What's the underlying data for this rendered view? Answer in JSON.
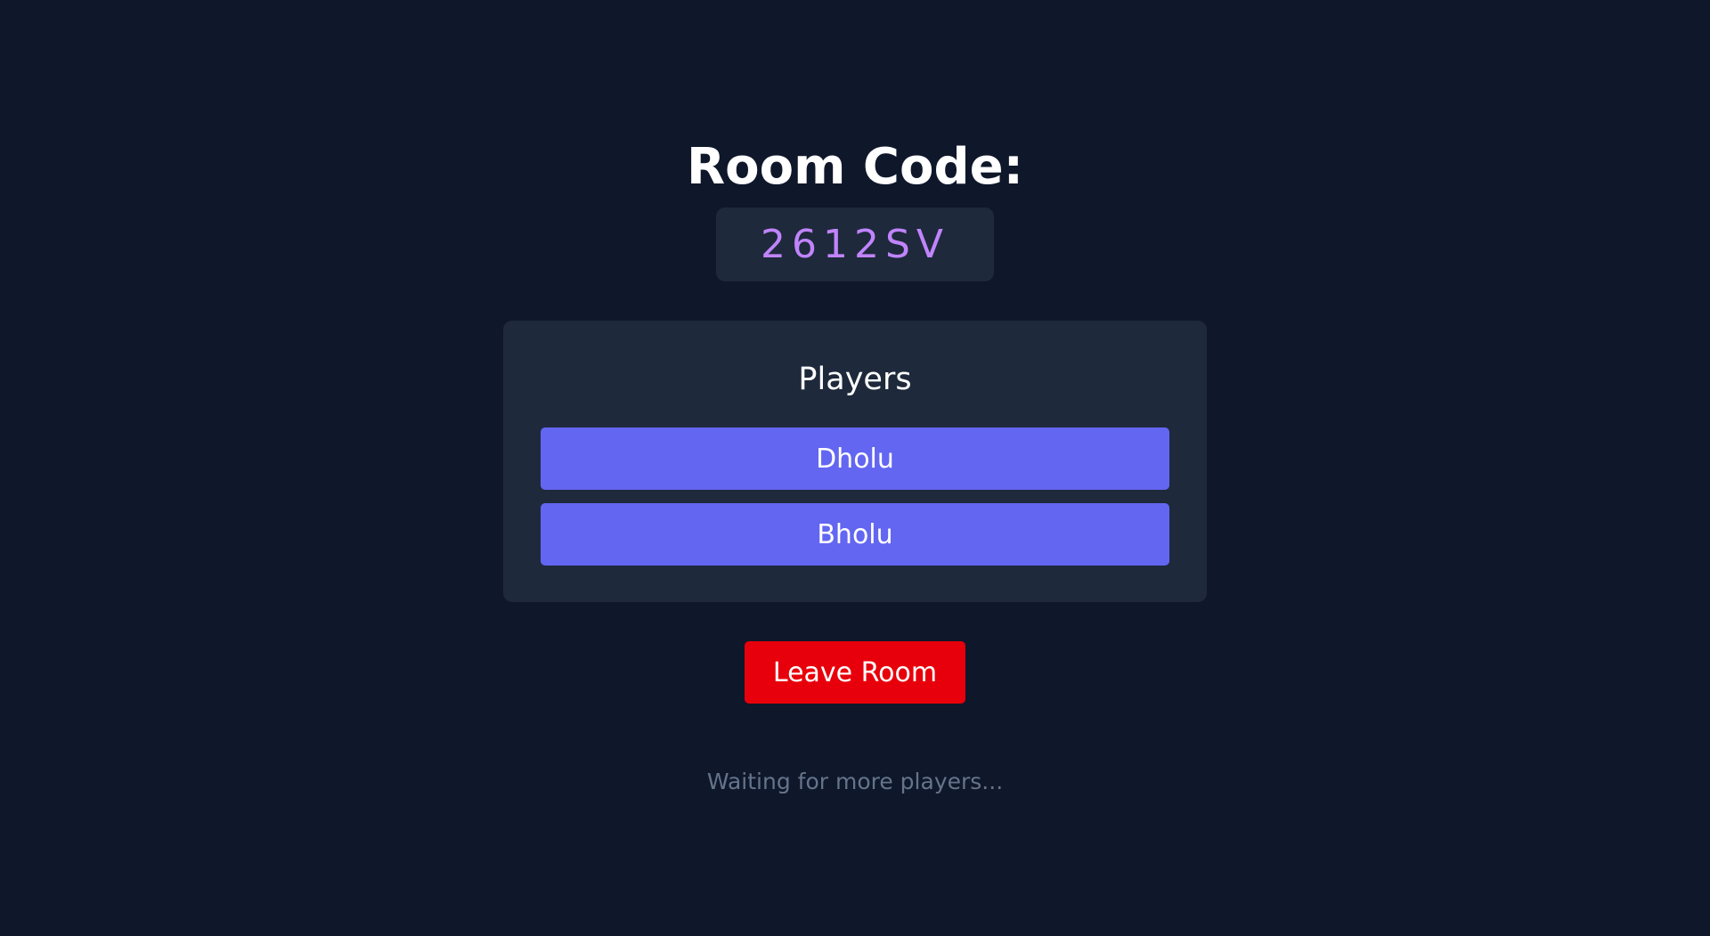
{
  "room": {
    "title": "Room Code:",
    "code": "2612SV"
  },
  "players": {
    "heading": "Players",
    "list": [
      {
        "name": "Dholu"
      },
      {
        "name": "Bholu"
      }
    ]
  },
  "actions": {
    "leave_label": "Leave Room"
  },
  "status": {
    "message": "Waiting for more players..."
  },
  "colors": {
    "background": "#0f172a",
    "card": "#1e293b",
    "room_code": "#c084fc",
    "player_item": "#6366f1",
    "leave_button": "#e7000b",
    "status_text": "#64748b"
  }
}
